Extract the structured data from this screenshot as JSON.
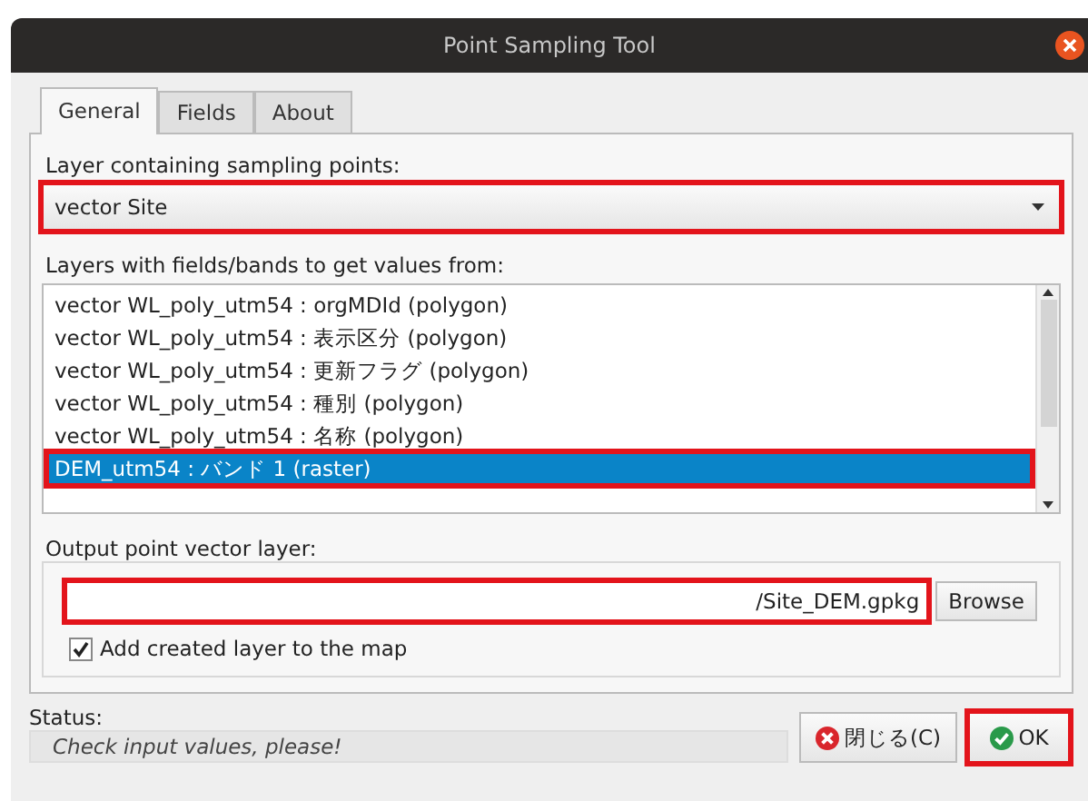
{
  "window": {
    "title": "Point Sampling Tool"
  },
  "tabs": [
    {
      "label": "General",
      "selected": true
    },
    {
      "label": "Fields",
      "selected": false
    },
    {
      "label": "About",
      "selected": false
    }
  ],
  "sampling_layer": {
    "label": "Layer containing sampling points:",
    "value": "vector Site",
    "highlighted": true
  },
  "value_layers": {
    "label": "Layers with fields/bands to get values from:",
    "items": [
      {
        "text": "vector WL_poly_utm54 : orgMDId (polygon)",
        "selected": false,
        "highlighted": false
      },
      {
        "text": "vector WL_poly_utm54 : 表示区分 (polygon)",
        "selected": false,
        "highlighted": false
      },
      {
        "text": "vector WL_poly_utm54 : 更新フラグ (polygon)",
        "selected": false,
        "highlighted": false
      },
      {
        "text": "vector WL_poly_utm54 : 種別 (polygon)",
        "selected": false,
        "highlighted": false
      },
      {
        "text": "vector WL_poly_utm54 : 名称 (polygon)",
        "selected": false,
        "highlighted": false
      },
      {
        "text": "DEM_utm54 : バンド 1 (raster)",
        "selected": true,
        "highlighted": true
      }
    ]
  },
  "output": {
    "label": "Output point vector layer:",
    "value": "/Site_DEM.gpkg",
    "highlighted": true,
    "browse": "Browse",
    "add_to_map": {
      "label": "Add created layer to the map",
      "checked": true
    }
  },
  "status": {
    "label": "Status:",
    "message": "Check input values, please!"
  },
  "buttons": [
    {
      "label": "閉じる(C)",
      "kind": "close",
      "highlighted": false
    },
    {
      "label": "OK",
      "kind": "ok",
      "highlighted": true
    }
  ]
}
